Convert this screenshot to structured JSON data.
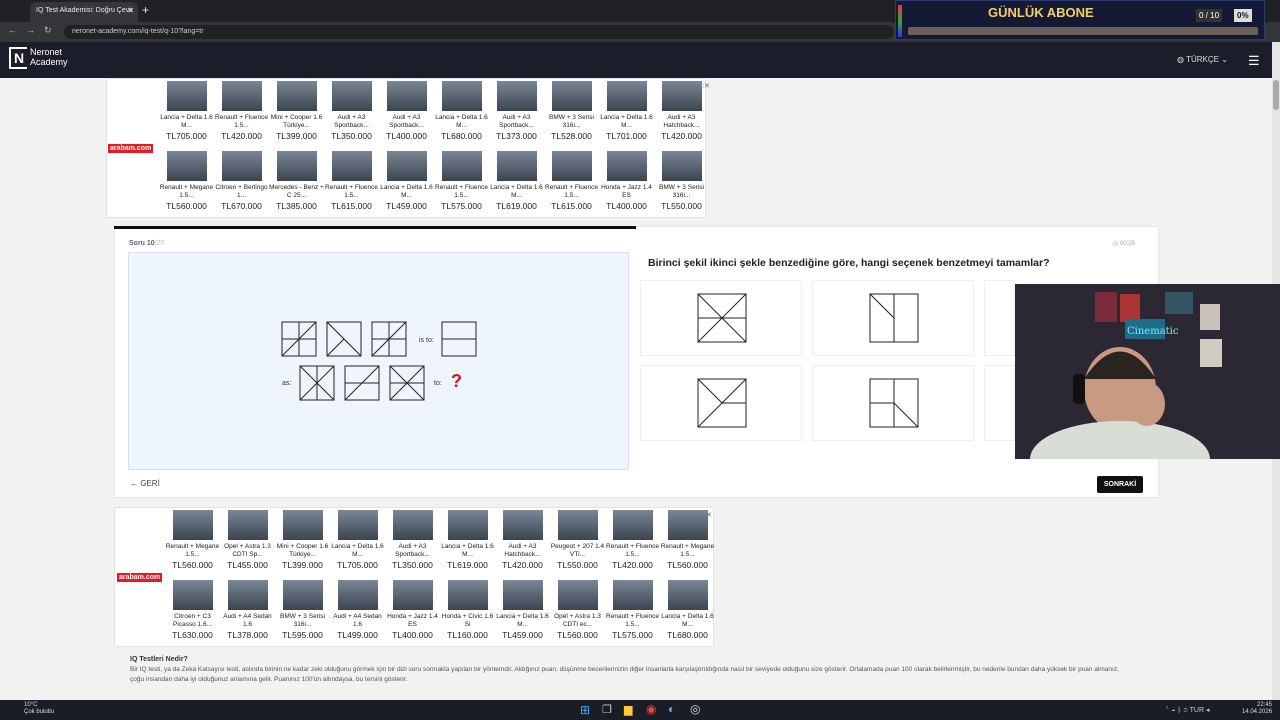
{
  "browser": {
    "tab_title": "IQ Test Akademisi: Doğru Çevir",
    "tab_close": "✕",
    "new_tab": "+",
    "url": "neronet-academy.com/iq-test/q-10?lang=tr"
  },
  "stream_overlay": {
    "label": "GÜNLÜK ABONE",
    "counter": "0 / 10",
    "percent": "0%"
  },
  "site": {
    "logo_line1": "Neronet",
    "logo_line2": "Academy",
    "language": "TÜRKÇE"
  },
  "ad_top": {
    "brand": "arabam.com",
    "items": [
      {
        "name": "Lancia + Delta 1.6 M...",
        "price": "TL705.000"
      },
      {
        "name": "Renault + Fluence 1.5...",
        "price": "TL420.000"
      },
      {
        "name": "Mini + Cooper 1.6 Türkiye...",
        "price": "TL399.000"
      },
      {
        "name": "Audi + A3 Sportback...",
        "price": "TL350.000"
      },
      {
        "name": "Audi + A3 Sportback...",
        "price": "TL400.000"
      },
      {
        "name": "Lancia + Delta 1.6 M...",
        "price": "TL680.000"
      },
      {
        "name": "Audi + A3 Sportback...",
        "price": "TL373.000"
      },
      {
        "name": "BMW + 3 Serisi 316i...",
        "price": "TL528.000"
      },
      {
        "name": "Lancia + Delta 1.6 M...",
        "price": "TL701.000"
      },
      {
        "name": "Audi + A3 Hatchback...",
        "price": "TL420.000"
      },
      {
        "name": "Renault + Megane 1.5...",
        "price": "TL560.000"
      },
      {
        "name": "Citroen + Berlingo 1...",
        "price": "TL670.000"
      },
      {
        "name": "Mercedes - Benz + C 25...",
        "price": "TL385.000"
      },
      {
        "name": "Renault + Fluence 1.5...",
        "price": "TL615.000"
      },
      {
        "name": "Lancia + Delta 1.6 M...",
        "price": "TL459.000"
      },
      {
        "name": "Renault + Fluence 1.5...",
        "price": "TL575.000"
      },
      {
        "name": "Lancia + Delta 1.6 M...",
        "price": "TL619.000"
      },
      {
        "name": "Renault + Fluence 1.5...",
        "price": "TL615.000"
      },
      {
        "name": "Honda + Jazz 1.4 ES",
        "price": "TL400.000"
      },
      {
        "name": "BMW + 3 Serisi 316i...",
        "price": "TL550.000"
      }
    ]
  },
  "ad_bottom": {
    "brand": "arabam.com",
    "items": [
      {
        "name": "Renault + Megane 1.5...",
        "price": "TL560.000"
      },
      {
        "name": "Opel + Astra 1.3 CDTI Sp...",
        "price": "TL455.000"
      },
      {
        "name": "Mini + Cooper 1.6 Türkiye...",
        "price": "TL399.000"
      },
      {
        "name": "Lancia + Delta 1.6 M...",
        "price": "TL705.000"
      },
      {
        "name": "Audi + A3 Sportback...",
        "price": "TL350.000"
      },
      {
        "name": "Lancia + Delta 1.6 M...",
        "price": "TL619.000"
      },
      {
        "name": "Audi + A3 Hatchback...",
        "price": "TL420.000"
      },
      {
        "name": "Peugeot + 207 1.4 VTi...",
        "price": "TL550.000"
      },
      {
        "name": "Renault + Fluence 1.5...",
        "price": "TL420.000"
      },
      {
        "name": "Renault + Megane 1.5...",
        "price": "TL560.000"
      },
      {
        "name": "Citroen + C3 Picasso 1.6...",
        "price": "TL630.000"
      },
      {
        "name": "Audi + A4 Sedan 1.6",
        "price": "TL378.000"
      },
      {
        "name": "BMW + 3 Serisi 316i...",
        "price": "TL595.000"
      },
      {
        "name": "Audi + A4 Sedan 1.6",
        "price": "TL499.000"
      },
      {
        "name": "Honda + Jazz 1.4 ES",
        "price": "TL400.000"
      },
      {
        "name": "Honda + Civic 1.6 Si",
        "price": "TL160.000"
      },
      {
        "name": "Lancia + Delta 1.6 M...",
        "price": "TL459.000"
      },
      {
        "name": "Opel + Astra 1.3 CDTI ec...",
        "price": "TL560.000"
      },
      {
        "name": "Renault + Fluence 1.5...",
        "price": "TL575.000"
      },
      {
        "name": "Lancia + Delta 1.6 M...",
        "price": "TL680.000"
      }
    ]
  },
  "quiz": {
    "soru_label": "Soru 10",
    "soru_total": "/20",
    "timer": "00:25",
    "question": "Birinci şekil ikinci şekle benzediğine göre, hangi seçenek benzetmeyi tamamlar?",
    "puzzle_is_to": "is to:",
    "puzzle_as": "as:",
    "puzzle_to": "to:",
    "puzzle_question_mark": "?",
    "back_label": "GERİ",
    "next_label": "SONRAKİ"
  },
  "info": {
    "title": "IQ Testleri Nedir?",
    "text": "Bir IQ testi, ya da Zeka Katsayısı testi, aslında birinin ne kadar zeki olduğunu görmek için bir dizi soru sormakla yapılan bir yöntemdir. Aldığınız puan, düşünme becerilerinizin diğer insanlarla karşılaştırıldığında nasıl bir seviyede olduğunu size gösterir. Ortalamada puan 100 olarak belirlenmiştir, bu nedenle bundan daha yüksek bir puan almanız, çoğu insandan daha iyi olduğunuz anlamına gelir. Puanınız 100'ün altındaysa, bu tersini gösterir."
  },
  "taskbar": {
    "temp": "10°C",
    "weather": "Çok bulutlu",
    "time": "22:45",
    "date": "14.04.2026",
    "lang": "TUR"
  }
}
